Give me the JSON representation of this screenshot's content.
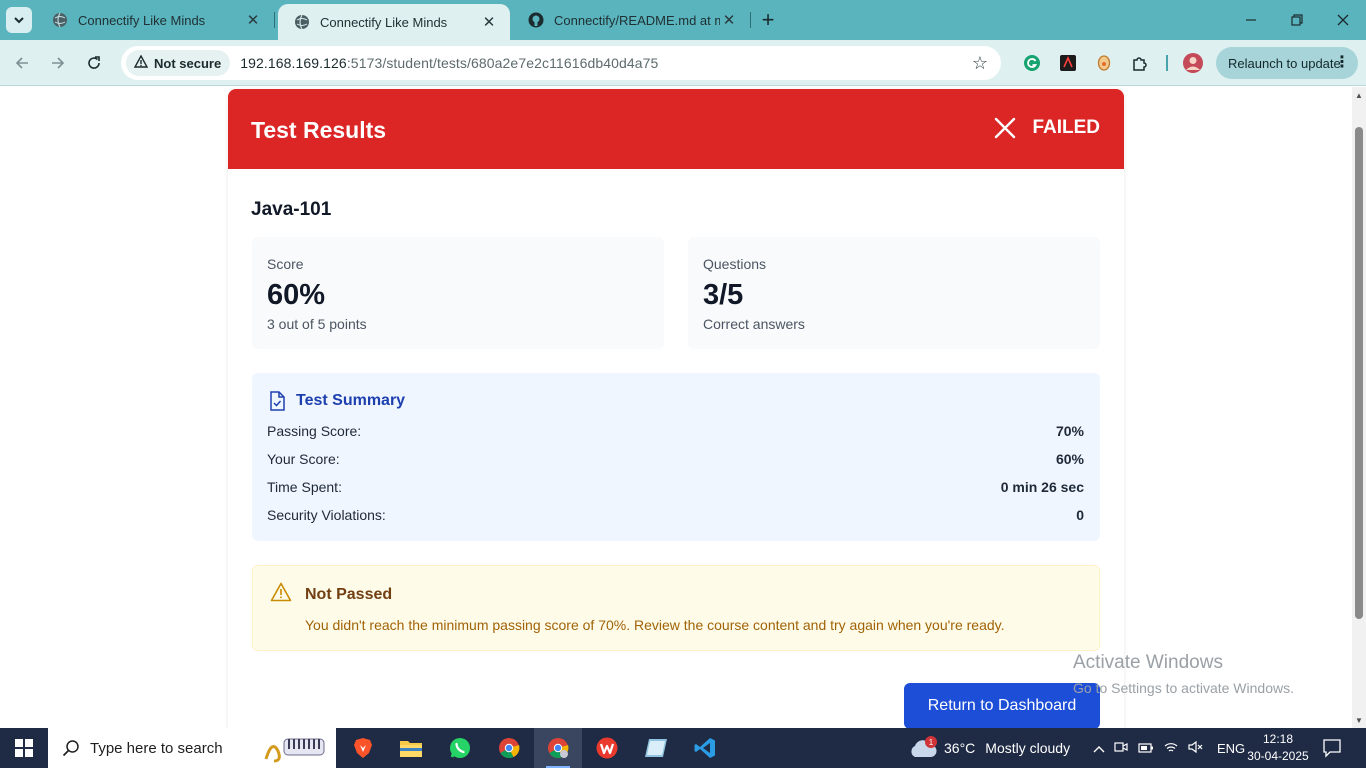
{
  "browser": {
    "tabs": [
      {
        "title": "Connectify Like Minds",
        "active": false
      },
      {
        "title": "Connectify Like Minds",
        "active": true
      },
      {
        "title": "Connectify/README.md at mai",
        "active": false
      }
    ],
    "security_chip": "Not secure",
    "url_host": "192.168.169.126",
    "url_path": ":5173/student/tests/680a2e7e2c11616db40d4a75",
    "relaunch_label": "Relaunch to update"
  },
  "result": {
    "header_title": "Test Results",
    "status_label": "FAILED",
    "test_name": "Java-101",
    "score": {
      "label": "Score",
      "value": "60%",
      "sub": "3 out of 5 points"
    },
    "questions": {
      "label": "Questions",
      "value": "3/5",
      "sub": "Correct answers"
    },
    "summary": {
      "title": "Test Summary",
      "rows": [
        {
          "label": "Passing Score:",
          "value": "70%"
        },
        {
          "label": "Your Score:",
          "value": "60%"
        },
        {
          "label": "Time Spent:",
          "value": "0 min 26 sec"
        },
        {
          "label": "Security Violations:",
          "value": "0"
        }
      ]
    },
    "notice": {
      "title": "Not Passed",
      "message": "You didn't reach the minimum passing score of 70%. Review the course content and try again when you're ready."
    },
    "dashboard_button": "Return to Dashboard"
  },
  "watermark": {
    "line1": "Activate Windows",
    "line2": "Go to Settings to activate Windows."
  },
  "taskbar": {
    "search_placeholder": "Type here to search",
    "weather_badge": "1",
    "weather_temp": "36°C",
    "weather_desc": "Mostly cloudy",
    "language": "ENG",
    "time": "12:18",
    "date": "30-04-2025"
  },
  "colors": {
    "header_red": "#dc2626",
    "primary_blue": "#1d4ed8",
    "summary_bg": "#eff6ff",
    "notice_bg": "#fefce8",
    "browser_frame": "#5ab4bd"
  }
}
